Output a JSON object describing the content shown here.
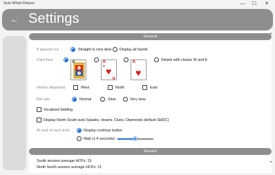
{
  "window": {
    "title": "Solo Whist Deluxe",
    "minimize": "—",
    "maximize": "☐",
    "close": "✕"
  },
  "header": {
    "back_icon": "←",
    "title": "Settings"
  },
  "sections": {
    "general": "General",
    "session": "Session"
  },
  "general": {
    "passed_out": {
      "label": "If passed out",
      "options": [
        "Straight to next deal",
        "Display all hands"
      ],
      "selected": 0
    },
    "card_face": {
      "label": "Card face",
      "option_simple": "Simple with classic W and E",
      "selected": 0
    },
    "hands_displayed": {
      "label": "Hands displayed",
      "options": [
        "West",
        "North",
        "East"
      ]
    },
    "bid_rate": {
      "label": "Bid rate",
      "options": [
        "Normal",
        "Slow",
        "Very slow"
      ],
      "selected": 0
    },
    "vocalized_bidding": "Vocalized bidding",
    "display_north_south": "Display North South suits Spades, Hearts, Clubs, Diamonds (default SHDC)",
    "end_of_trick": {
      "label": "At end of each trick",
      "options": [
        "Display continue button",
        "Wait (1-4 seconds)"
      ],
      "selected": 0,
      "wait_fraction": 0.5
    }
  },
  "session": {
    "south_hcp": "South session average HCPs: 15",
    "north_south_hcp": "North South session average HCPs: 21"
  },
  "cards": {
    "rank": "K",
    "suit": "♥",
    "suit_color": "#d42020"
  },
  "colors": {
    "accent": "#1e6fd0",
    "section_bar": "#8e8e8e"
  }
}
